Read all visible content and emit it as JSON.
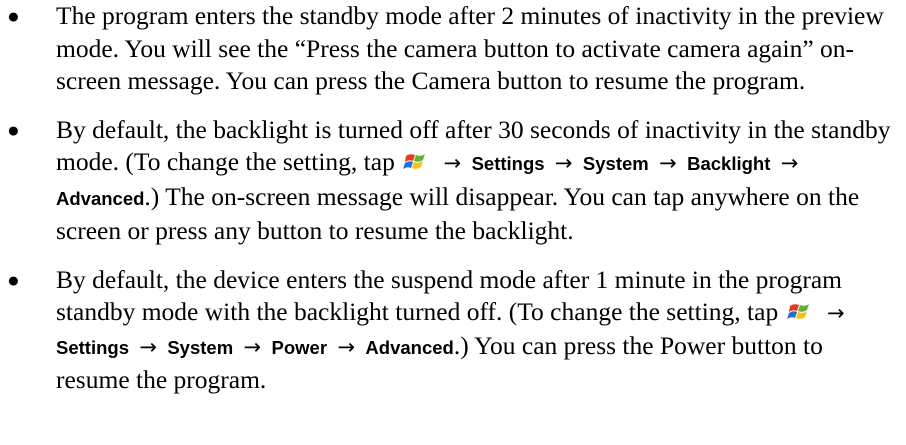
{
  "items": [
    {
      "text1": "The program enters the standby mode after 2 minutes of inactivity in the preview mode. You will see the “Press the camera button to activate camera again” on-screen message. You can press the Camera button to resume the program."
    },
    {
      "text1": "By default, the backlight is turned off after 30 seconds of inactivity in the standby mode. (To change the setting, tap",
      "ui_settings": "Settings",
      "ui_system": "System",
      "ui_backlight": "Backlight",
      "ui_advanced": "Advanced",
      "text2": ".) The on-screen message will disappear. You can tap anywhere on the screen or press any button to resume the backlight."
    },
    {
      "text1": "By default, the device enters the suspend mode after 1 minute in the program standby mode with the backlight turned off. (To change the setting, tap",
      "ui_settings": "Settings",
      "ui_system": "System",
      "ui_power": "Power",
      "ui_advanced": "Advanced",
      "text2": ".) You can press the Power button to resume the program."
    }
  ],
  "bullet_glyph": "●",
  "arrow_glyph": "→",
  "icons": {
    "start": "windows-start-icon"
  }
}
